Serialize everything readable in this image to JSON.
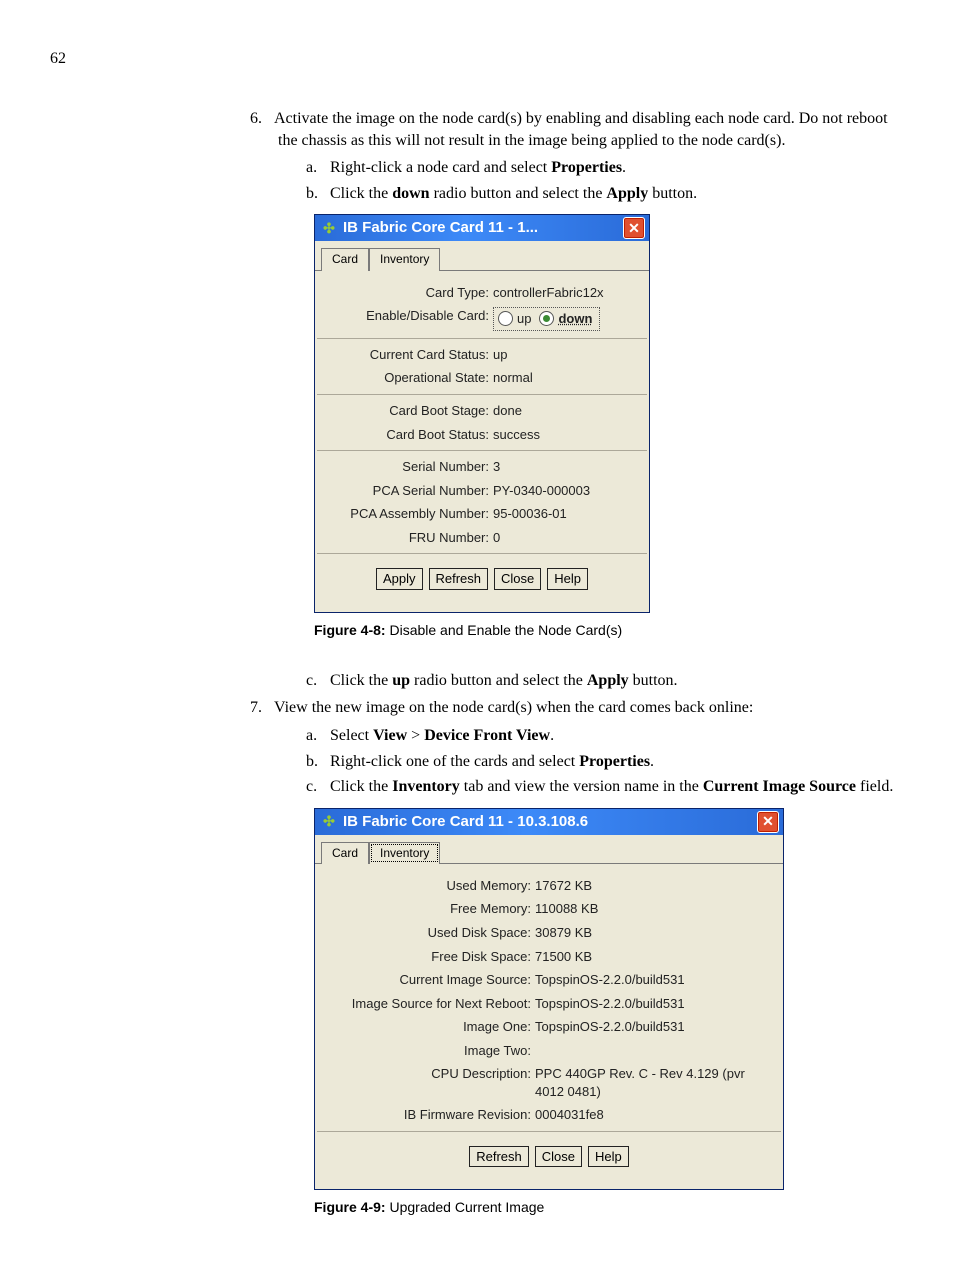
{
  "page_number": "62",
  "step6": {
    "num": "6.",
    "text_a": "Activate the image on the node card(s) by enabling and disabling each node card. Do not reboot the chassis as this will not result in the image being applied to the node card(s).",
    "a": {
      "let": "a.",
      "t1": "Right-click a node card and select ",
      "b1": "Properties",
      "t2": "."
    },
    "b": {
      "let": "b.",
      "t1": "Click the ",
      "b1": "down",
      "t2": " radio button and select the ",
      "b2": "Apply",
      "t3": " button."
    },
    "c": {
      "let": "c.",
      "t1": "Click the ",
      "b1": "up",
      "t2": " radio button and select the ",
      "b2": "Apply",
      "t3": " button."
    }
  },
  "fig1": {
    "label": "Figure 4-8:",
    "caption": " Disable and Enable the Node Card(s)"
  },
  "step7": {
    "num": "7.",
    "text": "View the new image on the node card(s) when the card comes back online:",
    "a": {
      "let": "a.",
      "t1": "Select ",
      "b1": "View",
      "sep": " > ",
      "b2": "Device Front View",
      "t2": "."
    },
    "b": {
      "let": "b.",
      "t1": "Right-click one of the cards and select ",
      "b1": "Properties",
      "t2": "."
    },
    "c": {
      "let": "c.",
      "t1": "Click the ",
      "b1": "Inventory",
      "t2": " tab and view the version name in the ",
      "b2": "Current Image Source",
      "t3": " field."
    }
  },
  "fig2": {
    "label": "Figure 4-9:",
    "caption": " Upgraded Current Image"
  },
  "dlg1": {
    "title": "IB Fabric Core Card 11 - 1...",
    "tab_card": "Card",
    "tab_inventory": "Inventory",
    "rows": {
      "card_type_k": "Card Type:",
      "card_type_v": "controllerFabric12x",
      "enable_k": "Enable/Disable Card:",
      "up": "up",
      "down": "down",
      "status_k": "Current Card Status:",
      "status_v": "up",
      "opstate_k": "Operational State:",
      "opstate_v": "normal",
      "bootstage_k": "Card Boot Stage:",
      "bootstage_v": "done",
      "bootstat_k": "Card Boot Status:",
      "bootstat_v": "success",
      "serial_k": "Serial Number:",
      "serial_v": "3",
      "pca_serial_k": "PCA Serial Number:",
      "pca_serial_v": "PY-0340-000003",
      "pca_asm_k": "PCA Assembly Number:",
      "pca_asm_v": "95-00036-01",
      "fru_k": "FRU Number:",
      "fru_v": "0"
    },
    "btn_apply": "Apply",
    "btn_refresh": "Refresh",
    "btn_close": "Close",
    "btn_help": "Help"
  },
  "dlg2": {
    "title": "IB Fabric Core Card 11 - 10.3.108.6",
    "tab_card": "Card",
    "tab_inventory": "Inventory",
    "rows": {
      "usedmem_k": "Used Memory:",
      "usedmem_v": "17672 KB",
      "freemem_k": "Free Memory:",
      "freemem_v": "110088 KB",
      "useddisk_k": "Used Disk Space:",
      "useddisk_v": "30879 KB",
      "freedisk_k": "Free Disk Space:",
      "freedisk_v": "71500 KB",
      "cis_k": "Current Image Source:",
      "cis_v": "TopspinOS-2.2.0/build531",
      "nis_k": "Image Source for Next Reboot:",
      "nis_v": "TopspinOS-2.2.0/build531",
      "img1_k": "Image One:",
      "img1_v": "TopspinOS-2.2.0/build531",
      "img2_k": "Image Two:",
      "img2_v": "",
      "cpu_k": "CPU Description:",
      "cpu_v": "PPC 440GP Rev. C - Rev 4.129 (pvr 4012 0481)",
      "fw_k": "IB Firmware Revision:",
      "fw_v": "0004031fe8"
    },
    "btn_refresh": "Refresh",
    "btn_close": "Close",
    "btn_help": "Help"
  }
}
